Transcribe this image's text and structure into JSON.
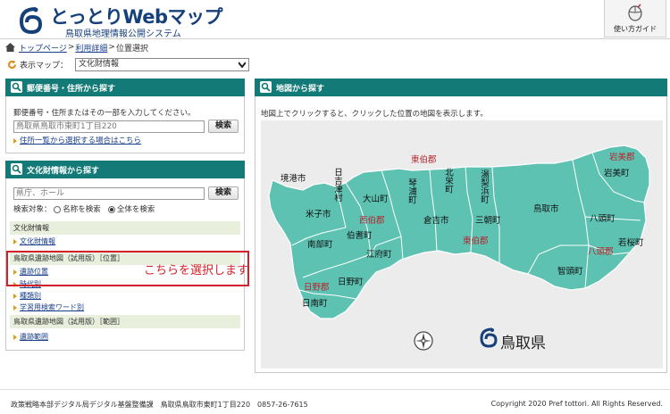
{
  "header": {
    "title": "とっとりWebマップ",
    "subtitle": "鳥取県地理情報公開システム",
    "guide_label": "使い方ガイド"
  },
  "breadcrumb": {
    "items": [
      "トップページ",
      "利用詳細",
      "位置選択"
    ]
  },
  "map_select": {
    "label": "表示マップ：",
    "value": "文化財情報"
  },
  "address_search": {
    "title": "郵便番号・住所から探す",
    "instruction": "郵便番号・住所またはその一部を入力してください。",
    "placeholder": "鳥取県鳥取市東町1丁目220",
    "button": "検索",
    "link": "住所一覧から選択する場合はこちら"
  },
  "cultural_search": {
    "title": "文化財情報から探す",
    "placeholder": "県庁、ホール",
    "button": "検索",
    "target_label": "検索対象：",
    "option_name": "名称を検索",
    "option_all": "全体を検索",
    "category1": "文化財情報",
    "category1_items": [
      "文化財情報"
    ],
    "category2": "鳥取県遺跡地図（試用版）［位置］",
    "category2_items": [
      "遺跡位置",
      "時代別",
      "種類別",
      "学習用検索ワード別"
    ],
    "category3": "鳥取県遺跡地図（試用版）［範囲］",
    "category3_items": [
      "遺跡範囲"
    ],
    "callout": "こちらを選択します"
  },
  "map_panel": {
    "title": "地図から探す",
    "instruction": "地図上でクリックすると、クリックした位置の地図を表示します。",
    "pref_name": "鳥取県",
    "districts": [
      "東伯郡",
      "西伯郡",
      "東伯郡",
      "岩美郡",
      "八頭郡",
      "日野郡"
    ],
    "municipalities": [
      "境港市",
      "日吉津村",
      "北栄町",
      "湯梨浜町",
      "岩美町",
      "米子市",
      "大山町",
      "琴浦町",
      "倉吉市",
      "三朝町",
      "鳥取市",
      "八頭町",
      "南部町",
      "伯耆町",
      "若桜町",
      "江府町",
      "日野町",
      "智頭町",
      "日南町"
    ]
  },
  "footer": {
    "left": "政策戦略本部デジタル局デジタル基盤整備課　鳥取県鳥取市東町1丁目220　0857-26-7615",
    "right": "Copyright 2020 Pref tottori. All Rights Reserved."
  },
  "colors": {
    "panel_head": "#137a77",
    "map_fill": "#5ec2b3",
    "highlight": "#d3212b",
    "district_label": "#b3262c"
  }
}
